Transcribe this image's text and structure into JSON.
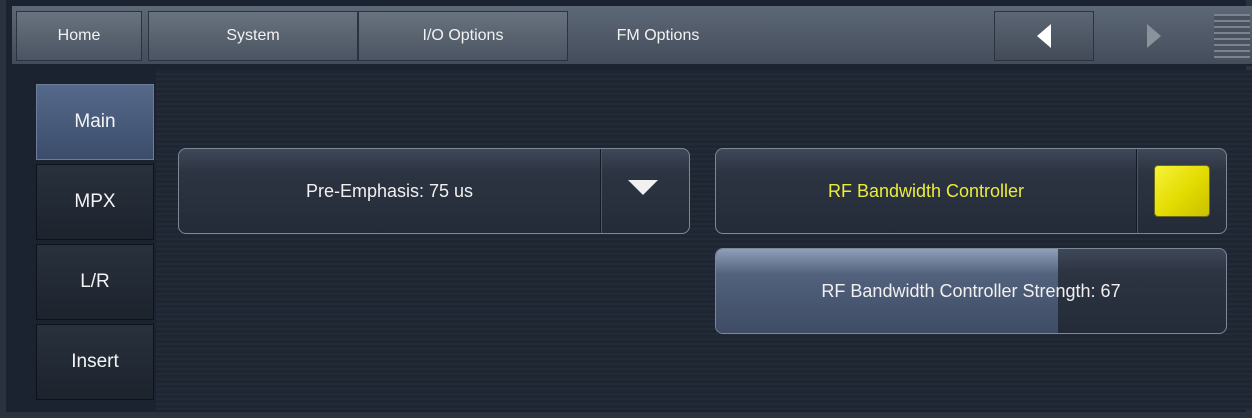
{
  "top_tabs": [
    {
      "label": "Home"
    },
    {
      "label": "System"
    },
    {
      "label": "I/O Options"
    },
    {
      "label": "FM Options"
    }
  ],
  "nav_arrows": {
    "back": "left-arrow-icon",
    "forward": "right-arrow-icon"
  },
  "menu_icon": "hamburger-icon",
  "sidebar": {
    "items": [
      {
        "label": "Main",
        "active": true
      },
      {
        "label": "MPX",
        "active": false
      },
      {
        "label": "L/R",
        "active": false
      },
      {
        "label": "Insert",
        "active": false
      }
    ]
  },
  "controls": {
    "pre_emphasis": {
      "label": "Pre-Emphasis: 75 us",
      "icon": "dropdown-caret-icon"
    },
    "rf_bw_controller": {
      "label": "RF Bandwidth Controller",
      "checked": true,
      "color": "#ebe300"
    },
    "rf_bw_strength": {
      "label": "RF Bandwidth Controller Strength: 67",
      "value": 67,
      "min": 0,
      "max": 100
    }
  },
  "colors": {
    "active_nav": "#4a5c7d",
    "highlight_text": "#ecec3c",
    "background": "#1e2632"
  }
}
